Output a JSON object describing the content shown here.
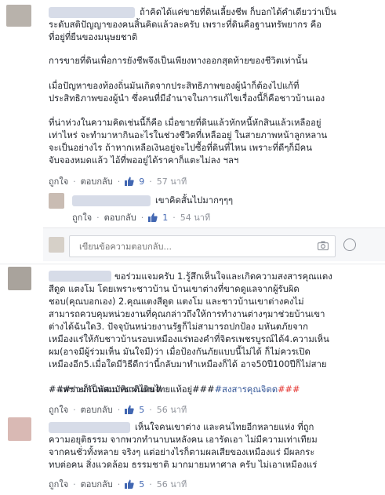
{
  "comments": [
    {
      "lines": [
        "ถ้าคิดได้แค่ขายที่ดินเลี้ยงชีพ ก็บอกได้คำเดียวว่าเป็น",
        "ระดับสติปัญญาของคนสิ้นคิดแล้วละครับ เพราะที่ดินคือฐานทรัพยากร คือ",
        "ที่อยู่ที่ยืนของมนุษยชาติ",
        "",
        "การขายที่ดินเพื่อการยังชีพจึงเป็นเพียงทางออกสุดท้ายของชีวิตเท่านั้น",
        "",
        "เมื่อปัญหาของท้องถิ่นมันเกิดจากประสิทธิภาพของผู้นำก็ต้องไปแก้ที่",
        "ประสิทธิภาพของผู้นำ ซึ่งคนที่มีอำนาจในการแก้ไขเรื่องนี้ก็คือชาวบ้านเอง",
        "",
        "ที่น่าห่วงในความคิดเช่นนี้ก็คือ เมื่อขายที่ดินแล้วหักหนี้หักสินแล้วเหลืออยู่",
        "เท่าไหร่ จะทำมาหากินอะไรในช่วงชีวิตที่เหลืออยู่ ในสายภาพหน้าลูกหลาน",
        "จะเป็นอย่างไร ถ้าหากเหลือเงินอยู่จะไปซื้อที่ดินที่ไหน เพราะที่ดีๆก็มีคน",
        "จับจองหมดแล้ว ไอ้ที่พออยู่ได้ราคาก็แตะไม่ลง ฯลฯ"
      ],
      "like_label": "ถูกใจ",
      "reply_label": "ตอบกลับ",
      "likes": "9",
      "time": "57 นาที"
    },
    {
      "lines": [
        "เขาคิดสั้นไปมากๆๆๆ"
      ],
      "like_label": "ถูกใจ",
      "reply_label": "ตอบกลับ",
      "likes": "1",
      "time": "54 นาที"
    },
    {
      "lines": [
        "ขอร่วมแจมครับ 1.รู้สึกเห็นใจและเกิดความสงสารคุณแตง",
        "สีดูด แตงโม โดยเพราะชาวบ้าน บ้านเขาต่างที่ขาดดูแลจากผู้รับผิด",
        "ชอบ(คุณบอกเอง) 2.คุณแตงสีดูด แตงโม และชาวบ้านเขาต่างคงไม่",
        "สามารถควบคุมหน่วยงานที่คุณกล่าวถึงให้การทำงานต่างๆมาช่วยบ้านเขา",
        "ต่างได้ฉันใด3. ปัจจุบันหน่วยงานรัฐก็ไม่สามารถปกป้อง มหันตภัยจาก",
        "เหมืองแร่ให้กับชาวบ้านรอบเหมืองแร่ทองคำที่จิตรเพชรบูรณ์ได้4.ความเห็น",
        "ผม(อาจมีผู้ร่วมเห็น มันใจมี)ว่า เมื่อป้องกันภัยแบบนี้ไม่ได้ ก็ไม่ควรเปิด",
        "เหมืองอีก5.เมื่อใดมีวิธีดีกว่านี้กลับมาทำเหมืองก็ได้ อาจ50ปี100ปีก็ไม่สาย",
        "เพราะก็เป็นสมบัติแผ่นดินไทยแท้อยู่###",
        "###ร่วมกันพัฒนาชาติไทย#"
      ],
      "hashtag_1": "#สงสารคุณจิตต",
      "hashtag_2": "###",
      "like_label": "ถูกใจ",
      "reply_label": "ตอบกลับ",
      "likes": "5",
      "time": "56 นาที"
    },
    {
      "lines": [
        "เห็นใจคนเขาต่าง และคนไทยอีกหลายแห่ง ที่ถูก",
        "ความอยุติธรรม จากพวกทำนาบนหลังคน เอารัดเอา ไม่มีความเท่าเทียม",
        "จากคนชั่วทั้งหลาย จริงๆ แต่อย่างไรก็ตามผลเสียของเหมืองแร่ มีผลกระ",
        "ทบต่อคน สิ่งแวดล้อม ธรรมชาติ มากมายมหาศาล ครับ ไม่เอาเหมืองแร่"
      ],
      "like_label": "ถูกใจ",
      "reply_label": "ตอบกลับ",
      "likes": "5",
      "time": "56 นาที"
    }
  ],
  "reply_box": {
    "placeholder": "เขียนข้อความตอบกลับ..."
  },
  "colors": {
    "link": "#4267b2",
    "meta": "#90949c",
    "text": "#1d2129"
  }
}
